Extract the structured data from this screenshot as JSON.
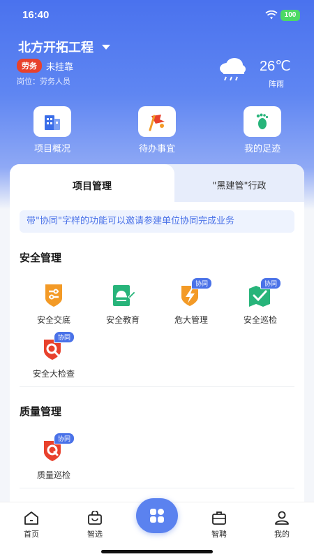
{
  "status": {
    "time": "16:40",
    "battery": "100"
  },
  "project": {
    "name": "北方开拓工程",
    "tag": "劳务",
    "affiliation": "未挂靠",
    "post": "岗位：劳务人员"
  },
  "weather": {
    "temp": "26℃",
    "condition": "阵雨",
    "icon": "rain-cloud-icon"
  },
  "quick": [
    {
      "label": "项目概况",
      "icon": "building-icon"
    },
    {
      "label": "待办事宜",
      "icon": "flag-icon"
    },
    {
      "label": "我的足迹",
      "icon": "footprint-icon"
    }
  ],
  "tabs": {
    "active": "项目管理",
    "other": "\"黑建管\"行政"
  },
  "notice": "带\"协同\"字样的功能可以邀请参建单位协同完成业务",
  "sections": {
    "safety": {
      "title": "安全管理",
      "items": [
        {
          "label": "安全交底",
          "icon": "shield-sliders-icon"
        },
        {
          "label": "安全教育",
          "icon": "helmet-book-icon"
        },
        {
          "label": "危大管理",
          "icon": "lightning-shield-icon",
          "tag": "协同"
        },
        {
          "label": "安全巡检",
          "icon": "map-check-icon",
          "tag": "协同"
        },
        {
          "label": "安全大检查",
          "icon": "search-shield-icon",
          "tag": "协同"
        }
      ]
    },
    "quality": {
      "title": "质量管理",
      "items": [
        {
          "label": "质量巡检",
          "icon": "quality-shield-icon",
          "tag": "协同"
        }
      ]
    }
  },
  "nav": [
    {
      "label": "首页",
      "icon": "home-icon"
    },
    {
      "label": "智选",
      "icon": "shopping-bag-icon"
    },
    {
      "label": "",
      "icon": "apps-icon"
    },
    {
      "label": "智聘",
      "icon": "briefcase-icon"
    },
    {
      "label": "我的",
      "icon": "user-icon"
    }
  ],
  "colors": {
    "primary": "#4a72ee",
    "accent_orange": "#f39a26",
    "accent_red": "#e8412c",
    "accent_green": "#27b47a"
  }
}
